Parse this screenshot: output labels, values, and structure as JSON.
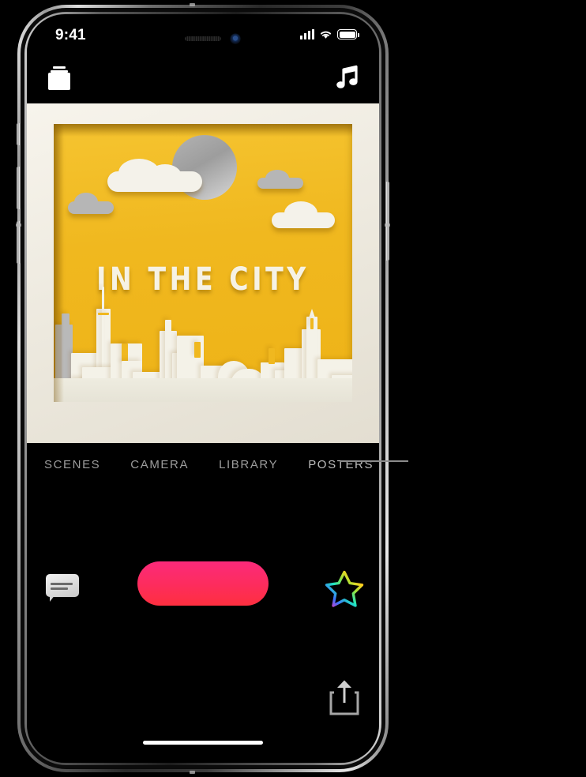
{
  "device": {
    "type": "iphone-x",
    "status_bar": {
      "time": "9:41",
      "signal_icon": "cellular-bars-icon",
      "wifi_icon": "wifi-icon",
      "battery_icon": "battery-full-icon"
    }
  },
  "top_bar": {
    "scenes_button": {
      "icon": "scenes-stack-icon",
      "label": "Scenes"
    },
    "music_button": {
      "icon": "music-note-icon",
      "label": "Music"
    }
  },
  "poster": {
    "title": "IN THE CITY",
    "style": "paper-craft city skyline",
    "frame_color": "#f2efe6",
    "background_color": "#f0b81f",
    "sun_color": "#b3b3b3",
    "building_color": "#eceade",
    "title_color": "#f6f2e4"
  },
  "tabs": [
    {
      "label": "SCENES",
      "active": false
    },
    {
      "label": "CAMERA",
      "active": false
    },
    {
      "label": "LIBRARY",
      "active": false
    },
    {
      "label": "POSTERS",
      "active": true
    }
  ],
  "controls": {
    "chat_button": {
      "icon": "chat-bubble-icon",
      "label": "Comment"
    },
    "record_button": {
      "label": "",
      "color_top": "#fb2a7b",
      "color_bottom": "#fe2f3f"
    },
    "effects_button": {
      "icon": "rainbow-star-icon",
      "label": "Effects"
    }
  },
  "share": {
    "icon": "share-icon",
    "label": "Share"
  },
  "callout": {
    "target_tab": "POSTERS",
    "color": "#8c8c8c"
  }
}
